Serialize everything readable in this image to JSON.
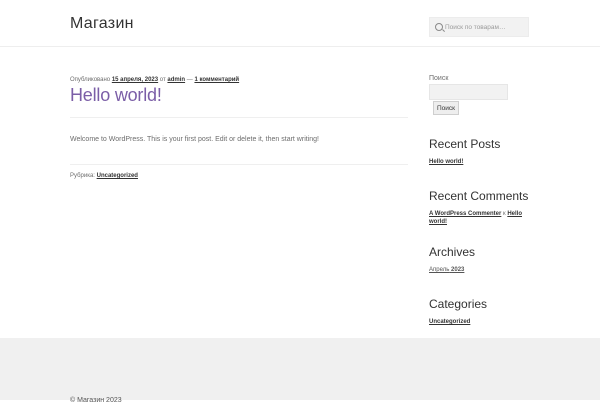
{
  "header": {
    "site_title": "Магазин",
    "search_placeholder": "Поиск по товарам…"
  },
  "post": {
    "meta_prefix": "Опубликовано ",
    "date": "15 апреля, 2023",
    "by": " от ",
    "author": "admin",
    "separator": " — ",
    "comments": "1 комментарий",
    "title": "Hello world!",
    "content": "Welcome to WordPress. This is your first post. Edit or delete it, then start writing!",
    "category_label": "Рубрика: ",
    "category": "Uncategorized"
  },
  "sidebar": {
    "search_label": "Поиск",
    "search_button": "Поиск",
    "recent_posts": {
      "title": "Recent Posts",
      "items": [
        "Hello world!"
      ]
    },
    "recent_comments": {
      "title": "Recent Comments",
      "author": "A WordPress Commenter",
      "connector": " к ",
      "post": "Hello world!"
    },
    "archives": {
      "title": "Archives",
      "month": "Апрель",
      "year": "2023"
    },
    "categories": {
      "title": "Categories",
      "items": [
        "Uncategorized"
      ]
    }
  },
  "footer": {
    "copyright": "© Магазин 2023"
  }
}
